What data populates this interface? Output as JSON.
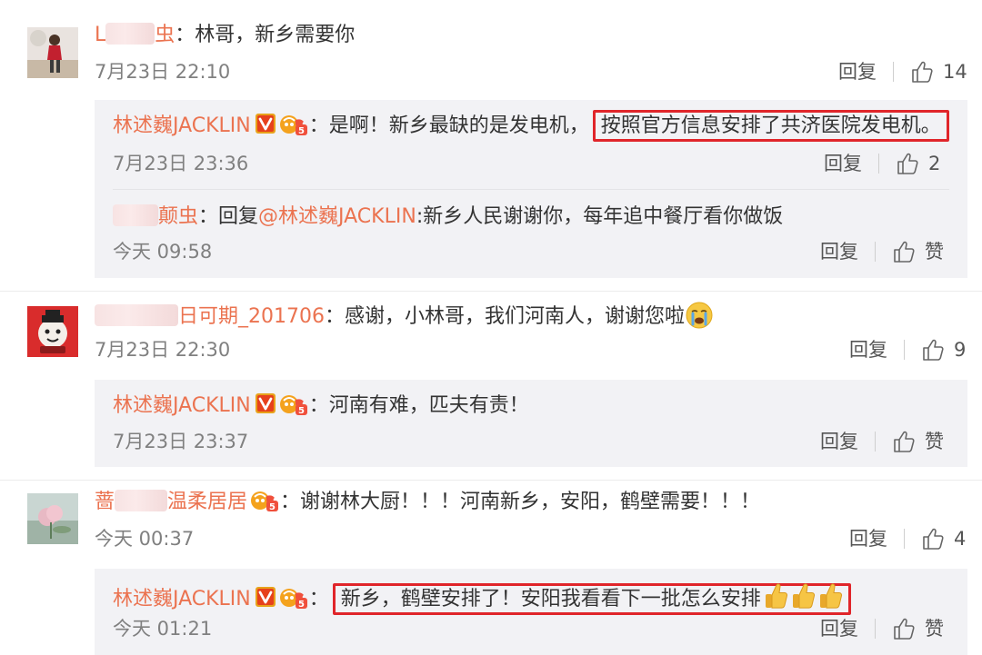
{
  "comments": [
    {
      "username_visible": "L",
      "username_suffix": "虫",
      "text": "林哥，新乡需要你",
      "date": "7月23日 22:10",
      "reply_label": "回复",
      "likes": "14",
      "replies": [
        {
          "username": "林述巍JACKLIN",
          "text_plain": "是啊！新乡最缺的是发电机，",
          "text_highlight": "按照官方信息安排了共济医院发电机。",
          "date": "7月23日 23:36",
          "reply_label": "回复",
          "likes": "2"
        },
        {
          "username_suffix": "颠虫",
          "reply_prefix": "回复",
          "mention": "@林述巍JACKLIN",
          "text": ":新乡人民谢谢你，每年追中餐厅看你做饭",
          "date": "今天 09:58",
          "reply_label": "回复",
          "likes": "赞"
        }
      ]
    },
    {
      "username_suffix": "日可期_201706",
      "text": "感谢，小林哥，我们河南人，谢谢您啦",
      "emoji": "crying-face",
      "date": "7月23日 22:30",
      "reply_label": "回复",
      "likes": "9",
      "replies": [
        {
          "username": "林述巍JACKLIN",
          "text": "河南有难，匹夫有责！",
          "date": "7月23日 23:37",
          "reply_label": "回复",
          "likes": "赞"
        }
      ]
    },
    {
      "username_visible": "蔷",
      "username_suffix": "温柔居居",
      "text": "谢谢林大厨！！！河南新乡，安阳，鹤壁需要！！！",
      "date": "今天 00:37",
      "reply_label": "回复",
      "likes": "4",
      "replies": [
        {
          "username": "林述巍JACKLIN",
          "text_highlight": "新乡，鹤壁安排了！安阳我看看下一批怎么安排",
          "date": "今天 01:21",
          "reply_label": "回复",
          "likes": "赞"
        }
      ]
    }
  ],
  "colon": "：",
  "colors": {
    "username": "#eb7350",
    "highlight_border": "#e0252a",
    "reply_bg": "#f2f2f5",
    "meta": "#808080"
  }
}
